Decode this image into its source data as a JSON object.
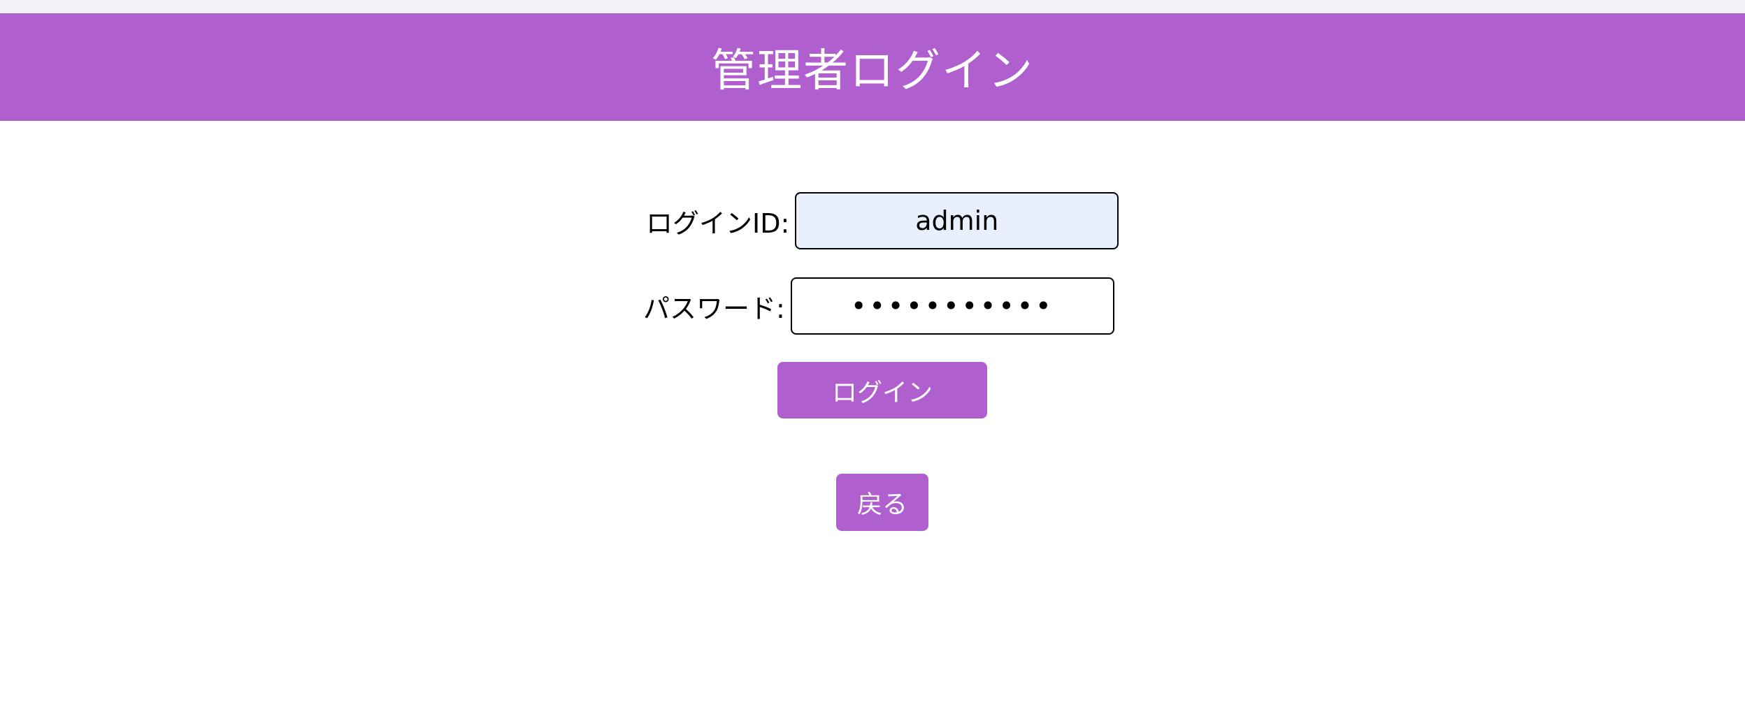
{
  "header": {
    "title": "管理者ログイン"
  },
  "form": {
    "login_id": {
      "label": "ログインID:",
      "value": "admin"
    },
    "password": {
      "label": "パスワード:",
      "value": "•••••••••••"
    },
    "login_button": "ログイン"
  },
  "back_button": "戻る",
  "colors": {
    "accent": "#b05fce",
    "autofill_bg": "#e8effd",
    "top_strip": "#f1f1f8"
  }
}
